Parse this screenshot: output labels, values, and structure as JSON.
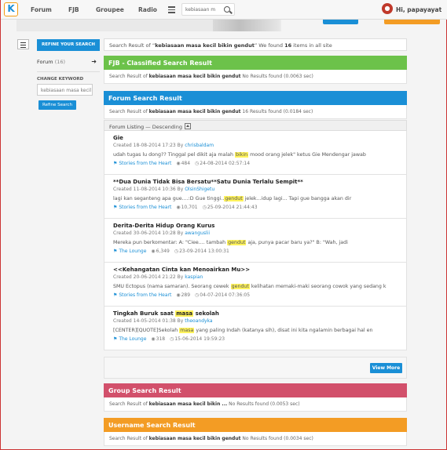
{
  "nav": {
    "logo": "K",
    "items": [
      "Forum",
      "FJB",
      "Groupee",
      "Radio"
    ],
    "search_placeholder": "kebiasaan m",
    "user_name": "Hi, papayayat"
  },
  "sidebar": {
    "refine_title": "REFINE YOUR SEARCH",
    "forum_label": "Forum",
    "forum_count": "(16)",
    "change_keyword": "CHANGE KEYWORD",
    "keyword_value": "kebiasaan masa kecil",
    "refine_button": "Refine Search"
  },
  "summary": {
    "prefix": "Search Result of “",
    "keyword": "kebiasaan masa kecil bikin gendut",
    "mid": "” We found ",
    "count": "16",
    "suffix": " items in all site"
  },
  "sections": {
    "fjb": {
      "title": "FJB - Classified Search Result",
      "line_prefix": "Search Result of ",
      "keyword": "kebiasaan masa kecil bikin gendut",
      "line_suffix": "  No Results found (0.0063 sec)",
      "color": "#6cc24a"
    },
    "forum": {
      "title": "Forum Search Result",
      "line_prefix": "Search Result of ",
      "keyword": "kebiasaan masa kecil bikin gendut",
      "line_suffix": " 16 Results found (0.0184 sec)",
      "color": "#1a8fd6"
    },
    "group": {
      "title": "Group Search Result",
      "line_prefix": "Search Result of ",
      "keyword": "kebiasaan masa kecil bikin ...",
      "line_suffix": "  No Results found (0.0053 sec)",
      "color": "#d2506b"
    },
    "username": {
      "title": "Username Search Result",
      "line_prefix": "Search Result of ",
      "keyword": "kebiasaan masa kecil bikin gendut",
      "line_suffix": "  No Results found (0.0034 sec)",
      "color": "#f39c24"
    }
  },
  "listing": {
    "label": "Forum Listing",
    "sort": " — Descending"
  },
  "threads": [
    {
      "title_parts": [
        "Gie"
      ],
      "created": "Created 18-08-2014 17:23 By ",
      "user": "chrisbaldam",
      "snip_before": "udah tugas lu dong?? Tinggal pel dikit aja malah ",
      "snip_hl": "bikin",
      "snip_after": " mood orang jelek\" ketus Gie Mendengar jawab",
      "forum": "Stories from the Heart",
      "views": "484",
      "last": "24-08-2014 02:57:14"
    },
    {
      "title_parts": [
        "**Dua Dunia Tidak Bisa Bersatu**Satu Dunia Terlalu Sempit**"
      ],
      "created": "Created 11-08-2014 10:36 By ",
      "user": "OlsinShigetu",
      "snip_before": "lagi kan seganteng apa gue....:D Gue tinggi..",
      "snip_hl": "gendut",
      "snip_after": " jelek...idup lagi... Tapi gue bangga akan dir",
      "forum": "Stories from the Heart",
      "views": "10,701",
      "last": "25-09-2014 21:44:43"
    },
    {
      "title_parts": [
        "Derita-Derita Hidup Orang Kurus"
      ],
      "created": "Created 30-06-2014 10:28 By ",
      "user": "awanguslii",
      "snip_before": "Mereka pun berkomentar: A: \"Ciee.... tambah ",
      "snip_hl": "gendut",
      "snip_after": " aja, punya pacar baru ya?\" B: \"Wah, jadi",
      "forum": "The Lounge",
      "views": "6,349",
      "last": "23-09-2014 13:00:31"
    },
    {
      "title_parts": [
        "<<Kehangatan Cinta kan Menoairkan Mu>>"
      ],
      "created": "Created 20-06-2014 21:22 By ",
      "user": "kaspian",
      "snip_before": "SMU Ectopus (nama samaran). Seorang cewek ",
      "snip_hl": "gendut",
      "snip_after": " kelihatan memaki-maki seorang cowok yang sedang k",
      "forum": "Stories from the Heart",
      "views": "289",
      "last": "04-07-2014 07:36:05"
    },
    {
      "title_parts": [
        "Tingkah Buruk saat ",
        "masa",
        " sekolah"
      ],
      "created": "Created 14-05-2014 01:38 By ",
      "user": "theoandyka",
      "snip_before": "[CENTER][QUOTE]Sekolah ",
      "snip_hl": "masa",
      "snip_after": " yang paling Indah (katanya sih), disat ini kita ngalamin berbagai hal en",
      "forum": "The Lounge",
      "views": "318",
      "last": "15-06-2014 19:59:23"
    }
  ],
  "view_more": "View More"
}
